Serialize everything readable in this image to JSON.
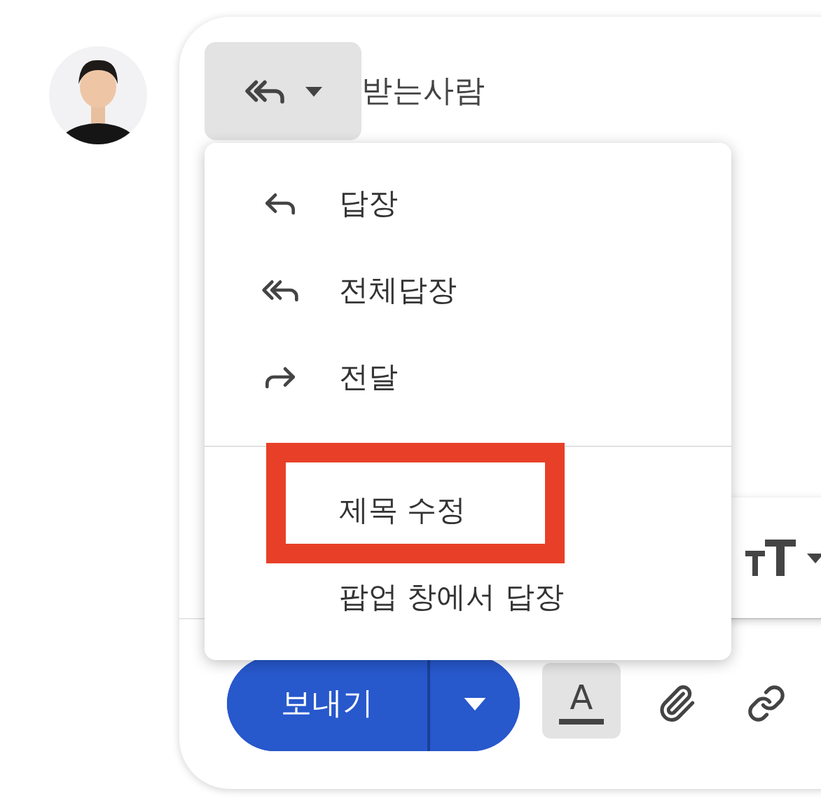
{
  "compose": {
    "reply_type_button": {
      "expanded": true
    },
    "recipients_label": "받는사람"
  },
  "menu": {
    "sections": [
      {
        "items": [
          {
            "kind": "reply",
            "label": "답장",
            "highlighted": false
          },
          {
            "kind": "reply_all",
            "label": "전체답장",
            "highlighted": false
          },
          {
            "kind": "forward",
            "label": "전달",
            "highlighted": false
          }
        ]
      },
      {
        "items": [
          {
            "kind": "plain",
            "label": "제목 수정",
            "highlighted": true
          },
          {
            "kind": "plain",
            "label": "팝업 창에서 답장",
            "highlighted": false
          }
        ]
      }
    ]
  },
  "send_button": {
    "label": "보내기"
  },
  "toolbar": {
    "text_color": {
      "glyph": "A",
      "selected": true
    }
  }
}
